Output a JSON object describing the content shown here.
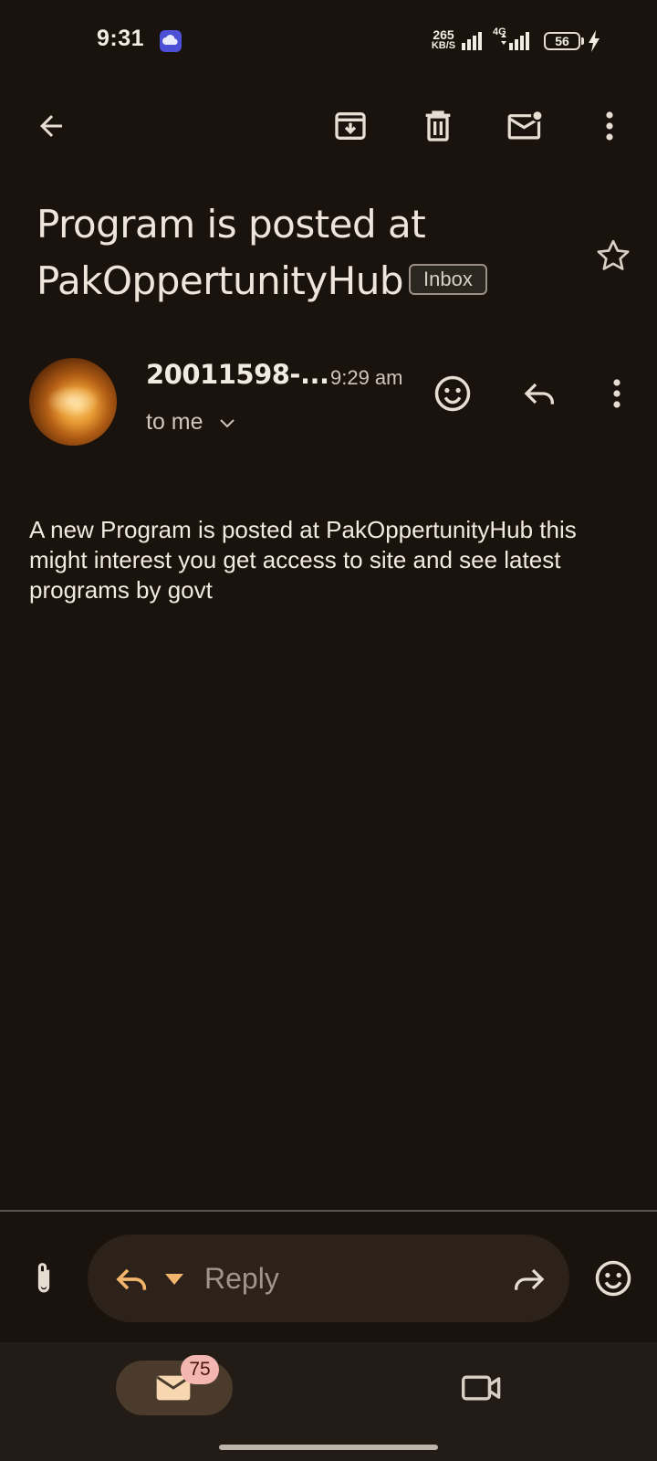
{
  "status_bar": {
    "time": "9:31",
    "speed_value": "265",
    "speed_unit": "KB/S",
    "network": "4G",
    "battery": "56"
  },
  "toolbar": {
    "back_icon": "arrow-left-icon",
    "archive_icon": "archive-icon",
    "delete_icon": "trash-icon",
    "mark_unread_icon": "mail-unread-icon",
    "more_icon": "more-vert-icon"
  },
  "email": {
    "subject": "Program is posted at PakOppertunityHub",
    "label": "Inbox",
    "sender": "20011598-...",
    "time": "9:29 am",
    "recipient": "to me",
    "body": "A new Program is posted at PakOppertunityHub this might interest you get access to site and see latest programs by govt"
  },
  "compose": {
    "reply_placeholder": "Reply"
  },
  "bottom_nav": {
    "mail_badge": "75"
  },
  "colors": {
    "background": "#1a130d",
    "accent": "#f2b56b",
    "badge": "#f3b6b0"
  }
}
